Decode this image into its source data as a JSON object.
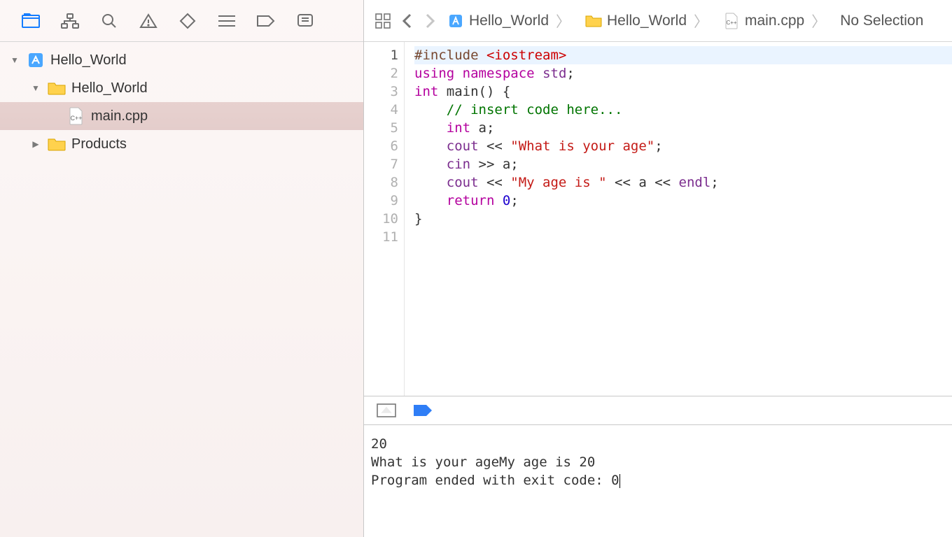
{
  "sidebar": {
    "project": {
      "label": "Hello_World"
    },
    "group": {
      "label": "Hello_World"
    },
    "file": {
      "label": "main.cpp"
    },
    "products": {
      "label": "Products"
    }
  },
  "breadcrumbs": {
    "project": "Hello_World",
    "group": "Hello_World",
    "file": "main.cpp",
    "selection": "No Selection"
  },
  "code": {
    "lines": [
      {
        "n": "1",
        "tokens": [
          [
            "pp",
            "#include "
          ],
          [
            "inc",
            "<iostream>"
          ]
        ]
      },
      {
        "n": "2",
        "tokens": [
          [
            "kw",
            "using"
          ],
          [
            "",
            " "
          ],
          [
            "kw",
            "namespace"
          ],
          [
            "",
            " "
          ],
          [
            "ns",
            "std"
          ],
          [
            "",
            ";"
          ]
        ]
      },
      {
        "n": "3",
        "tokens": [
          [
            "kw",
            "int"
          ],
          [
            "",
            " main() {"
          ]
        ]
      },
      {
        "n": "4",
        "tokens": [
          [
            "",
            "    "
          ],
          [
            "cmt",
            "// insert code here..."
          ]
        ]
      },
      {
        "n": "5",
        "tokens": [
          [
            "",
            "    "
          ],
          [
            "kw",
            "int"
          ],
          [
            "",
            " a;"
          ]
        ]
      },
      {
        "n": "6",
        "tokens": [
          [
            "",
            "    "
          ],
          [
            "ns",
            "cout"
          ],
          [
            "",
            " << "
          ],
          [
            "str",
            "\"What is your age\""
          ],
          [
            "",
            ";"
          ]
        ]
      },
      {
        "n": "7",
        "tokens": [
          [
            "",
            "    "
          ],
          [
            "ns",
            "cin"
          ],
          [
            "",
            " >> a;"
          ]
        ]
      },
      {
        "n": "8",
        "tokens": [
          [
            "",
            "    "
          ],
          [
            "ns",
            "cout"
          ],
          [
            "",
            " << "
          ],
          [
            "str",
            "\"My age is \""
          ],
          [
            "",
            " << a << "
          ],
          [
            "ns",
            "endl"
          ],
          [
            "",
            ";"
          ]
        ]
      },
      {
        "n": "9",
        "tokens": [
          [
            "",
            "    "
          ],
          [
            "kw",
            "return"
          ],
          [
            "",
            " "
          ],
          [
            "num",
            "0"
          ],
          [
            "",
            ";"
          ]
        ]
      },
      {
        "n": "10",
        "tokens": [
          [
            "",
            "}"
          ]
        ]
      },
      {
        "n": "11",
        "tokens": [
          [
            "",
            ""
          ]
        ]
      }
    ],
    "current_line": 1
  },
  "console": {
    "lines": [
      "20",
      "What is your ageMy age is 20",
      "Program ended with exit code: 0"
    ]
  }
}
